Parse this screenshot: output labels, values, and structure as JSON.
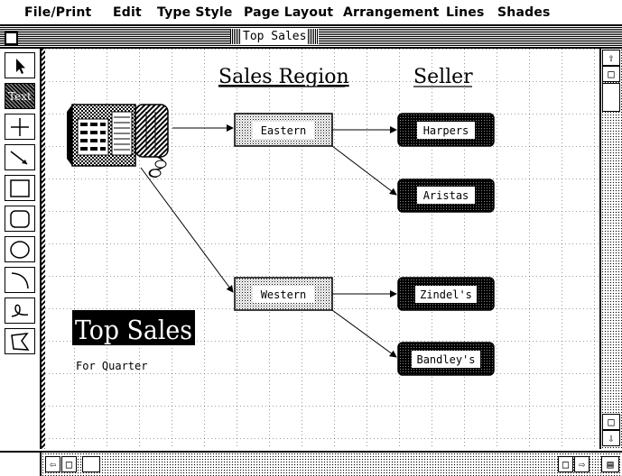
{
  "menubar": {
    "items": [
      "File/Print",
      "Edit",
      "Type Style",
      "Page Layout",
      "Arrangement",
      "Lines",
      "Shades"
    ]
  },
  "window": {
    "title": "Top Sales"
  },
  "palette": {
    "tools": [
      {
        "name": "arrow-tool",
        "icon": "arrow-pointer-icon"
      },
      {
        "name": "text-tool",
        "icon": "text-icon",
        "label": "Text"
      },
      {
        "name": "crosshair-tool",
        "icon": "crosshair-icon"
      },
      {
        "name": "line-tool",
        "icon": "line-icon"
      },
      {
        "name": "rectangle-tool",
        "icon": "rectangle-icon"
      },
      {
        "name": "rounded-rectangle-tool",
        "icon": "rounded-rectangle-icon"
      },
      {
        "name": "oval-tool",
        "icon": "oval-icon"
      },
      {
        "name": "arc-tool",
        "icon": "arc-icon"
      },
      {
        "name": "freehand-tool",
        "icon": "freehand-icon"
      },
      {
        "name": "polygon-tool",
        "icon": "polygon-icon"
      }
    ]
  },
  "document": {
    "header_region": "Sales Region",
    "header_seller": "Seller",
    "regions": [
      "Eastern",
      "Western"
    ],
    "sellers": [
      "Harpers",
      "Aristas",
      "Zindel's",
      "Bandley's"
    ],
    "big_title": "Top Sales",
    "subtitle": "For Quarter"
  },
  "scrollbars": {
    "vertical_icons": [
      "up-arrow-icon",
      "page-up-icon",
      "page-down-icon",
      "down-arrow-icon"
    ],
    "horizontal_icons": [
      "left-arrow-icon",
      "page-left-icon",
      "page-right-icon",
      "right-arrow-icon",
      "grow-box-icon"
    ]
  }
}
